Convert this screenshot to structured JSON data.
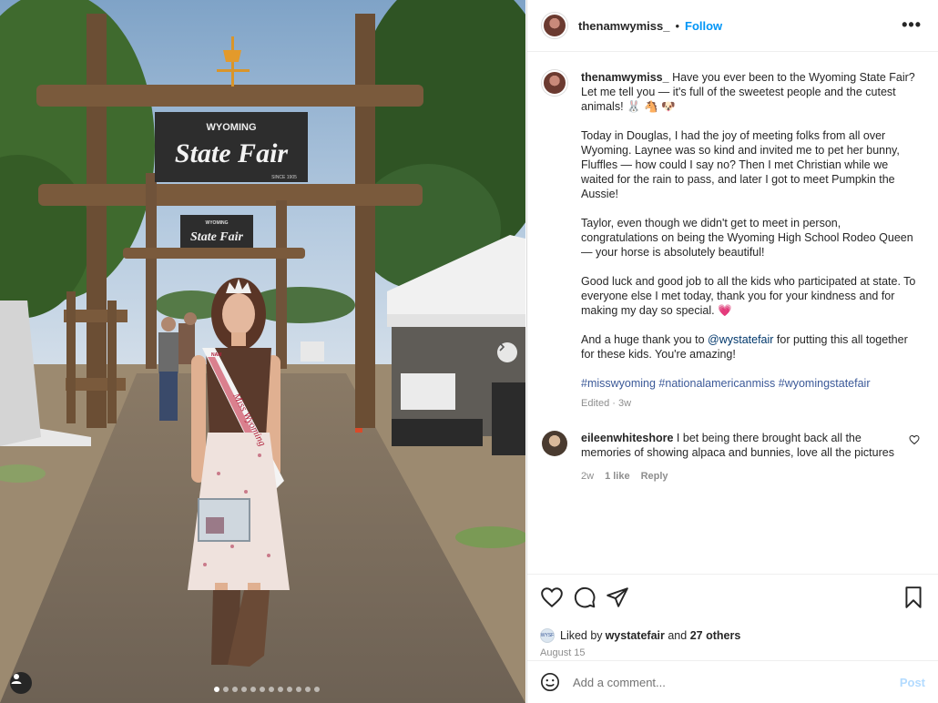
{
  "post": {
    "username": "thenamwymiss_",
    "follow_label": "Follow",
    "separator": "•",
    "more_label": "•••"
  },
  "photo": {
    "sign_top_line": "WYOMING",
    "sign_main": "State Fair",
    "sign_since": "SINCE 1905",
    "sign2_top": "WYOMING",
    "sign2_main": "State Fair",
    "sash_text": "Miss Wyoming",
    "sash_logo": "NAM",
    "carousel_count": 12,
    "carousel_active_index": 1,
    "next_icon": "chevron-right-icon",
    "tag_icon": "user-tag-icon"
  },
  "caption": {
    "username": "thenamwymiss_",
    "p1": "Have you ever been to the Wyoming State Fair? Let me tell you — it's full of the sweetest people and the cutest animals! 🐰 🐴 🐶",
    "p2": "Today in Douglas, I had the joy of meeting folks from all over Wyoming. Laynee was so kind and invited me to pet her bunny, Fluffles — how could I say no? Then I met Christian while we waited for the rain to pass, and later I got to meet Pumpkin the Aussie!",
    "p3": "Taylor, even though we didn't get to meet in person, congratulations on being the Wyoming High School Rodeo Queen — your horse is absolutely beautiful!",
    "p4": "Good luck and good job to all the kids who participated at state. To everyone else I met today, thank you for your kindness and for making my day so special. 💗",
    "p5_before": "And a huge thank you to ",
    "p5_mention": "@wystatefair",
    "p5_after": " for putting this all together for these kids. You're amazing!",
    "hashtags": "#misswyoming #nationalamericanmiss #wyomingstatefair",
    "meta": "Edited · 3w"
  },
  "comment": {
    "username": "eileenwhiteshore",
    "text": "I bet being there brought back all the memories of showing alpaca and bunnies, love all the pictures",
    "age": "2w",
    "likes": "1 like",
    "reply": "Reply"
  },
  "actions": {
    "liked_by_prefix": "Liked by ",
    "liked_by_user": "wystatefair",
    "liked_by_and": " and ",
    "liked_by_others": "27 others",
    "date": "August 15",
    "mini_avatar_text": "WYSF"
  },
  "add_comment": {
    "placeholder": "Add a comment...",
    "post_label": "Post"
  },
  "colors": {
    "link_blue": "#0095f6",
    "hashtag_blue": "#3b5998",
    "muted": "#8e8e8e",
    "post_disabled": "#b3dbff"
  }
}
